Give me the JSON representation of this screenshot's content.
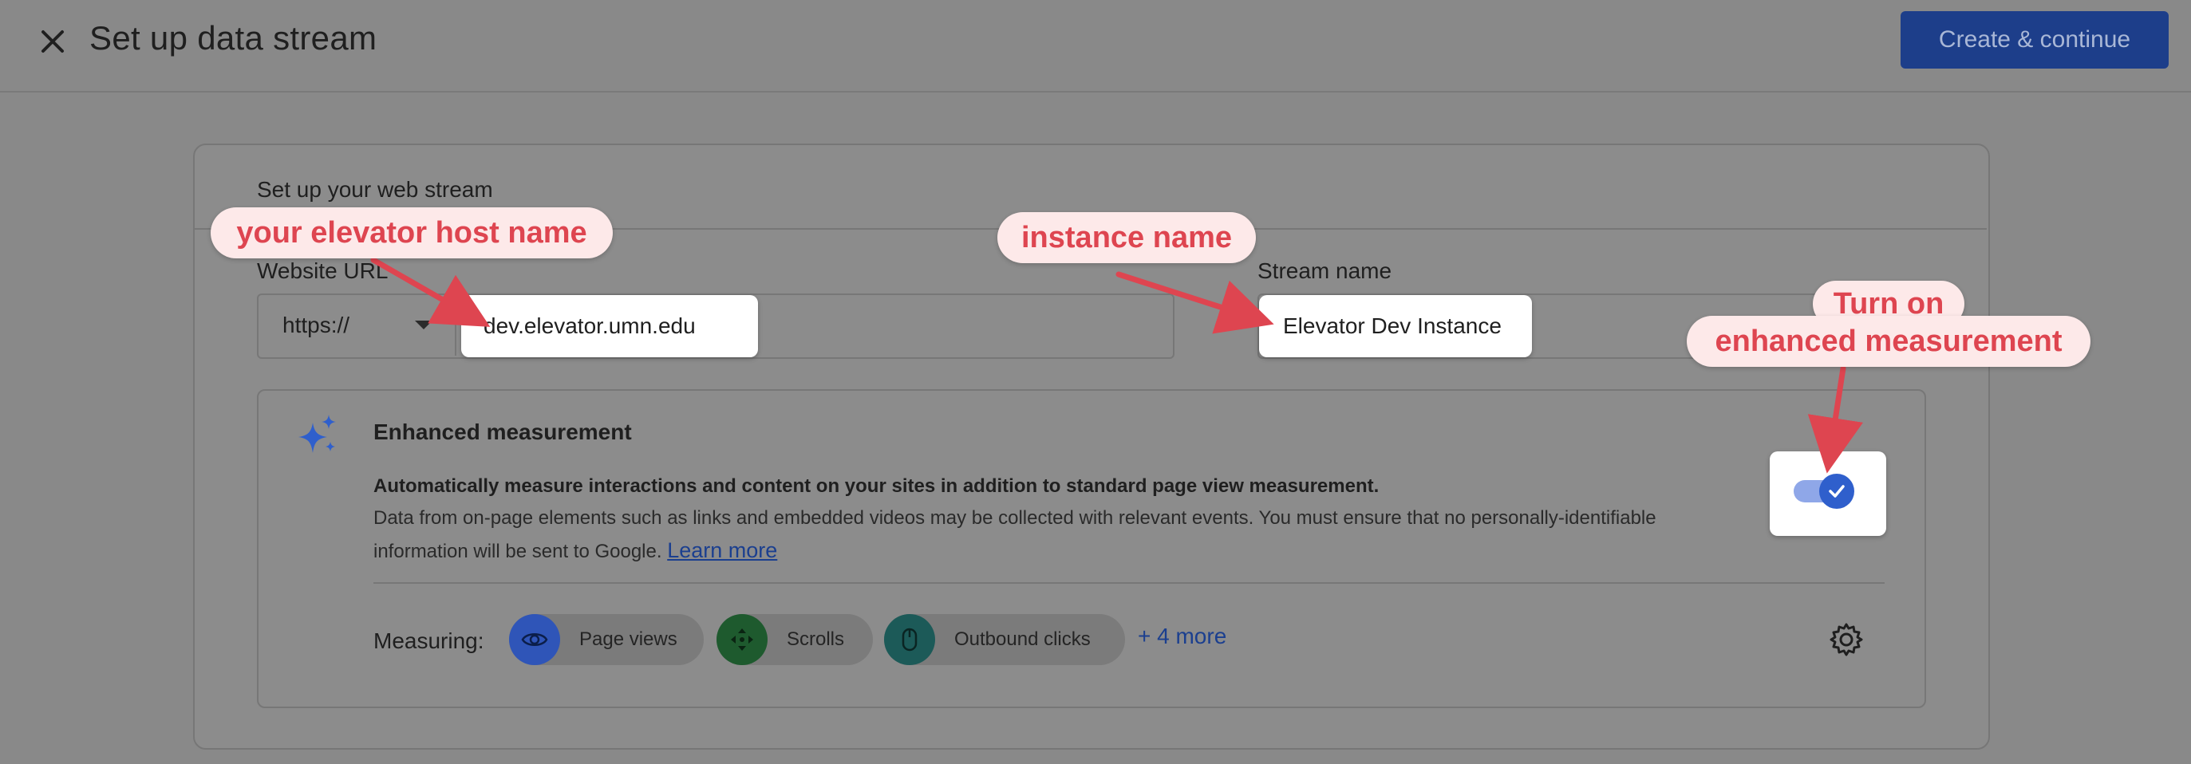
{
  "header": {
    "title": "Set up data stream",
    "create_button": "Create & continue"
  },
  "card": {
    "title": "Set up your web stream",
    "website_url": {
      "label": "Website URL",
      "protocol": "https://",
      "value": "dev.elevator.umn.edu"
    },
    "stream_name": {
      "label": "Stream name",
      "value": "Elevator Dev Instance"
    }
  },
  "enhanced_measurement": {
    "title": "Enhanced measurement",
    "description_bold": "Automatically measure interactions and content on your sites in addition to standard page view measurement.",
    "description": "Data from on-page elements such as links and embedded videos may be collected with relevant events. You must ensure that no personally-identifiable information will be sent to Google.",
    "learn_more": "Learn more",
    "enabled": true,
    "measuring_label": "Measuring:",
    "chips": [
      {
        "label": "Page views",
        "icon": "eye-icon",
        "color": "#2f55b8"
      },
      {
        "label": "Scrolls",
        "icon": "scroll-icon",
        "color": "#1e5a2e"
      },
      {
        "label": "Outbound clicks",
        "icon": "mouse-icon",
        "color": "#1c5a58"
      }
    ],
    "more_label": "+ 4 more"
  },
  "annotations": {
    "host": "your elevator host name",
    "instance": "instance name",
    "turn_on_line1": "Turn on",
    "turn_on_line2": "enhanced measurement"
  },
  "colors": {
    "accent": "#1d3e8a",
    "annotation": "#de4550",
    "annotation_bg": "#fde9e9",
    "toggle_on": "#2f5fcc"
  }
}
